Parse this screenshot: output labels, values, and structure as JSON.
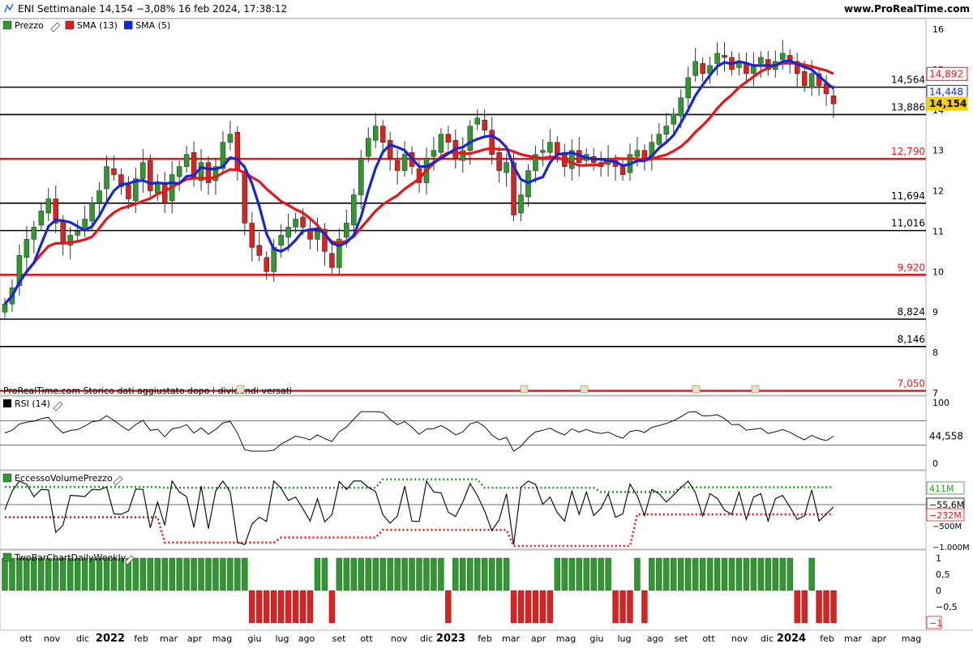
{
  "header": {
    "title": "ENI Settimanale 14,154 −3,08% 16 feb 2024, 17:38:12",
    "brand": "www.ProRealTime.com"
  },
  "colors": {
    "up": "#2e9a2e",
    "down": "#e01f1f",
    "sma13": "#e8161b",
    "sma5": "#1426d6",
    "support": "#000000",
    "resistance_red": "#e8161b"
  },
  "panels": {
    "price": {
      "legend": [
        {
          "icon": "candles-icon",
          "label": "Prezzo",
          "color": "#2e9a2e"
        },
        {
          "icon": "red-square-icon",
          "label": "SMA (13)",
          "color": "#e8161b"
        },
        {
          "icon": "blue-square-icon",
          "label": "SMA (5)",
          "color": "#1426d6"
        }
      ],
      "footer_note": "ProRealTime.com  Storico dati aggiustato dopo i dividendi versati",
      "axis_ticks": [
        "16",
        "15",
        "14",
        "13",
        "12",
        "11",
        "10",
        "9",
        "8",
        "7"
      ],
      "hlines": [
        {
          "label": "14,564",
          "value": 14.564,
          "color": "#000000"
        },
        {
          "label": "13,886",
          "value": 13.886,
          "color": "#000000"
        },
        {
          "label": "12,790",
          "value": 12.79,
          "color": "#e8161b"
        },
        {
          "label": "11,694",
          "value": 11.694,
          "color": "#000000"
        },
        {
          "label": "11,016",
          "value": 11.016,
          "color": "#000000"
        },
        {
          "label": "9,920",
          "value": 9.92,
          "color": "#e8161b"
        },
        {
          "label": "8,824",
          "value": 8.824,
          "color": "#000000"
        },
        {
          "label": "8,146",
          "value": 8.146,
          "color": "#000000"
        },
        {
          "label": "7,050",
          "value": 7.05,
          "color": "#e8161b"
        }
      ],
      "value_tags": [
        {
          "label": "14,892",
          "value": 14.892,
          "text_color": "#e8161b",
          "bg": "#ffffff",
          "border": "#e8161b"
        },
        {
          "label": "14,448",
          "value": 14.448,
          "text_color": "#1426d6",
          "bg": "#ffffff",
          "border": "#1426d6"
        },
        {
          "label": "14,154",
          "value": 14.154,
          "text_color": "#000000",
          "bg": "#f5d000",
          "border": "#f5d000"
        }
      ]
    },
    "rsi": {
      "legend": {
        "label": "RSI (14)",
        "color": "#000000"
      },
      "axis_ticks": [
        "100",
        "0"
      ],
      "value_tag": "44,558"
    },
    "volume": {
      "legend": {
        "label": "EccessoVolumePrezzo"
      },
      "axis_ticks": [
        "0",
        "−500M",
        "−1.000M"
      ],
      "value_tags": [
        {
          "label": "411M",
          "text_color": "#2e9a2e"
        },
        {
          "label": "−55,6M",
          "text_color": "#000000"
        },
        {
          "label": "−232M",
          "text_color": "#e8161b"
        }
      ]
    },
    "twobar": {
      "legend": {
        "label": "TwoBarChartDailyWeekly"
      },
      "axis_ticks": [
        "1",
        "0,5",
        "0",
        "−0,5"
      ],
      "value_tag": "−1"
    }
  },
  "chart_data": {
    "type": "candlestick",
    "title": "ENI Settimanale",
    "price_range": [
      7,
      16.2
    ],
    "x_labels": [
      "ott",
      "nov",
      "dic",
      "2022",
      "feb",
      "mar",
      "apr",
      "mag",
      "giu",
      "lug",
      "ago",
      "set",
      "ott",
      "nov",
      "dic",
      "2023",
      "feb",
      "mar",
      "apr",
      "mag",
      "giu",
      "lug",
      "ago",
      "set",
      "ott",
      "nov",
      "dic",
      "2024",
      "feb",
      "mar",
      "apr",
      "mag"
    ],
    "x_labels_bold": [
      "2022",
      "2023",
      "2024"
    ],
    "close": [
      9.2,
      9.6,
      10.4,
      10.8,
      11.1,
      11.5,
      11.8,
      11.2,
      10.7,
      10.9,
      11.0,
      11.3,
      11.7,
      12.0,
      12.6,
      12.4,
      12.1,
      11.8,
      12.3,
      12.7,
      12.0,
      12.2,
      11.7,
      12.4,
      12.6,
      12.9,
      12.3,
      12.7,
      12.2,
      12.6,
      13.2,
      13.4,
      12.5,
      11.2,
      10.6,
      10.4,
      10.0,
      10.6,
      10.9,
      11.1,
      11.3,
      11.1,
      10.8,
      11.0,
      10.5,
      10.1,
      10.8,
      11.2,
      11.9,
      12.8,
      13.3,
      13.6,
      13.2,
      12.8,
      12.5,
      12.9,
      12.6,
      12.2,
      12.8,
      13.0,
      13.4,
      13.2,
      12.8,
      13.0,
      13.6,
      13.8,
      13.5,
      12.9,
      12.5,
      12.7,
      11.4,
      11.9,
      12.5,
      12.9,
      13.0,
      13.2,
      12.9,
      12.6,
      13.0,
      12.7,
      12.9,
      12.7,
      12.6,
      12.8,
      12.6,
      12.4,
      12.9,
      13.0,
      12.8,
      13.2,
      13.4,
      13.6,
      13.9,
      14.3,
      14.8,
      15.2,
      14.9,
      15.1,
      15.4,
      15.3,
      15.0,
      15.2,
      14.9,
      15.1,
      15.3,
      15.0,
      15.2,
      15.4,
      15.2,
      14.9,
      14.6,
      14.9,
      14.6,
      14.4,
      14.15
    ],
    "sma13_last": 14.892,
    "sma5_last": 14.448,
    "last_close": 14.154,
    "change_pct": -3.08,
    "rsi_last": 44.558,
    "volume_excess_last": "-55,6M",
    "volume_upper_last": "411M",
    "volume_lower_last": "-232M"
  }
}
